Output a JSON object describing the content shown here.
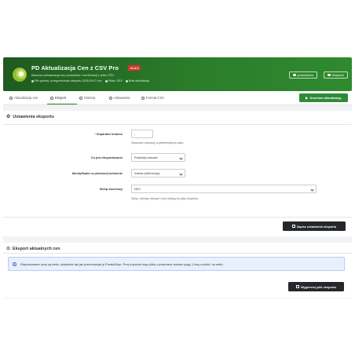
{
  "header": {
    "title": "PD Aktualizacja Cen z CSV Pro",
    "version": "v1.4.0",
    "description": "Masowa aktualizacja cen produktów i kombinacji z pliku CSV",
    "meta": [
      "Plik gotowy: przegrzeszanie-eksportu-2026-05-07.csv",
      "Sklep: DEV",
      "Brak aktualizacji"
    ],
    "buttons": [
      {
        "label": "pedsolutions",
        "icon": "globe-icon"
      },
      {
        "label": "Wsparcie",
        "icon": "support-icon"
      }
    ]
  },
  "tabs": [
    {
      "label": "Aktualizacja cen",
      "icon": "upload-icon"
    },
    {
      "label": "Eksport",
      "icon": "export-icon"
    },
    {
      "label": "Historia",
      "icon": "history-icon"
    },
    {
      "label": "Ustawienia",
      "icon": "gear-icon"
    },
    {
      "label": "Format CSV",
      "icon": "help-icon"
    }
  ],
  "run_button": "Uruchom aktualizację",
  "export_settings": {
    "title": "Ustawienia eksportu",
    "fields": {
      "separator_label": "Separator kolumn",
      "separator_value": ";",
      "separator_hint": "Separator używany w generowanym pliku.",
      "what_label": "Co jest eksportowane",
      "what_value": "Produkty bazowe",
      "identifier_label": "Identyfikator w pierwszej kolumnie",
      "identifier_value": "Indeks (referencja)",
      "shop_label": "Sklep docelowy",
      "shop_value": "DEV",
      "shop_hint": "Sklep, którego bieżące ceny trafiają do pliku eksportu."
    },
    "save_button": "Zapisz ustawienia eksportu"
  },
  "export_prices": {
    "title": "Eksport aktualnych cen",
    "alert": "Eksportowane ceny są netto, dokładnie tak jak przechowuje je PrestaShop. Przy imporcie tego pliku z powrotem zostaw opcję „Ceny w pliku” na netto.",
    "generate_button": "Wygeneruj plik eksportu"
  },
  "colors": {
    "header_green": "#2b7d2b",
    "accent_green": "#2e8b37",
    "dark_button": "#24272b",
    "alert_blue": "#e8f0fb",
    "badge_red": "#d3342f"
  }
}
